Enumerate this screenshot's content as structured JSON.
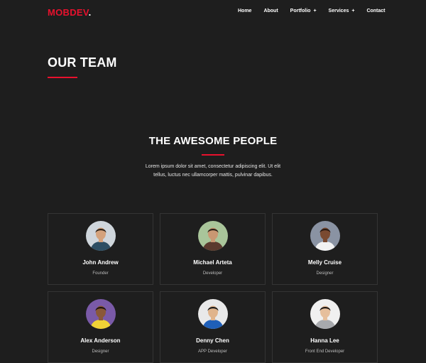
{
  "nav": {
    "logo_text": "MOBDEV",
    "logo_dot": ".",
    "items": [
      {
        "label": "Home"
      },
      {
        "label": "About"
      },
      {
        "label": "Portfolio",
        "plus": "+"
      },
      {
        "label": "Services",
        "plus": "+"
      },
      {
        "label": "Contact"
      }
    ]
  },
  "page_title": "OUR TEAM",
  "section": {
    "heading": "THE AWESOME PEOPLE",
    "description_line1": "Lorem ipsum dolor sit amet, consectetur adipiscing elit. Ut elit",
    "description_line2": "tellus, luctus nec ullamcorper mattis, pulvinar dapibus."
  },
  "team": [
    {
      "name": "John Andrew",
      "role": "Founder",
      "avatar_bg": "#cfd6dc",
      "skin": "#d4a27c",
      "hair": "#2b2118",
      "shirt": "#2d4e63"
    },
    {
      "name": "Michael Arteta",
      "role": "Developer",
      "avatar_bg": "#a9c59a",
      "skin": "#c99772",
      "hair": "#2a1f16",
      "shirt": "#5b3a2e"
    },
    {
      "name": "Melly Cruise",
      "role": "Designer",
      "avatar_bg": "#8a93a3",
      "skin": "#7a4a31",
      "hair": "#2a1a12",
      "shirt": "#f2f2f2"
    },
    {
      "name": "Alex Anderson",
      "role": "Designer",
      "avatar_bg": "#7a5aa8",
      "skin": "#8a5838",
      "hair": "#1d1410",
      "shirt": "#f0d236"
    },
    {
      "name": "Denny Chen",
      "role": "APP Developer",
      "avatar_bg": "#e9e9e9",
      "skin": "#e0b48c",
      "hair": "#1a1a1a",
      "shirt": "#1f5fb8"
    },
    {
      "name": "Hanna Lee",
      "role": "Front End Developer",
      "avatar_bg": "#f0f0f0",
      "skin": "#e6bf9c",
      "hair": "#1c1613",
      "shirt": "#a7a9ad"
    }
  ],
  "colors": {
    "accent": "#e8112d",
    "background": "#1e1e1e",
    "card_border": "#343434"
  }
}
